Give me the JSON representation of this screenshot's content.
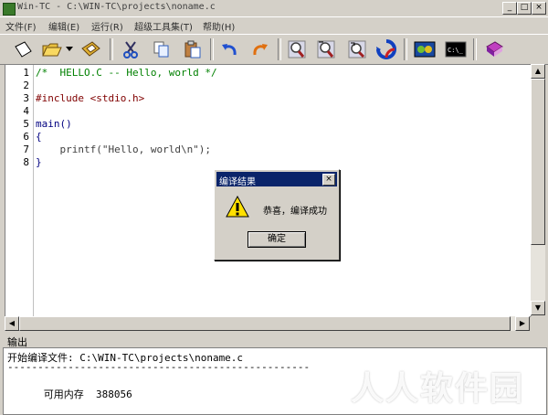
{
  "window": {
    "title": "Win-TC - C:\\WIN-TC\\projects\\noname.c",
    "minimize": "_",
    "maximize": "□",
    "close": "×"
  },
  "menu": [
    {
      "label": "文件(F)"
    },
    {
      "label": "编辑(E)"
    },
    {
      "label": "运行(R)"
    },
    {
      "label": "超级工具集(T)"
    },
    {
      "label": "帮助(H)"
    }
  ],
  "toolbar": {
    "icons": [
      "new-file-icon",
      "open-folder-icon",
      "dropdown-arrow-icon",
      "save-icon",
      "cut-icon",
      "copy-icon",
      "paste-icon",
      "undo-icon",
      "redo-icon",
      "find-icon",
      "find-next-icon",
      "replace-icon",
      "refresh-icon",
      "compile-icon",
      "run-console-icon",
      "help-book-icon"
    ]
  },
  "editor": {
    "line_numbers": [
      "1",
      "2",
      "3",
      "4",
      "5",
      "6",
      "7",
      "8"
    ],
    "lines": [
      {
        "text": "/*  HELLO.C -- Hello, world */",
        "color": "#008000"
      },
      {
        "text": "",
        "color": "#000000"
      },
      {
        "text": "#include <stdio.h>",
        "color": "#800000"
      },
      {
        "text": "",
        "color": "#000000"
      },
      {
        "text": "main()",
        "color": "#000080"
      },
      {
        "text": "{",
        "color": "#000080"
      },
      {
        "text": "    printf(\"Hello, world\\n\");",
        "color": "#404040"
      },
      {
        "text": "}",
        "color": "#000080"
      }
    ]
  },
  "dialog": {
    "title": "编译结果",
    "message": "恭喜，编译成功",
    "ok_label": "确定",
    "close": "×"
  },
  "output": {
    "label": "输出",
    "lines": [
      "开始编译文件: C:\\WIN-TC\\projects\\noname.c",
      "--------------------------------------------------",
      "",
      "      可用内存  388056"
    ]
  },
  "watermark": "人人软件园"
}
